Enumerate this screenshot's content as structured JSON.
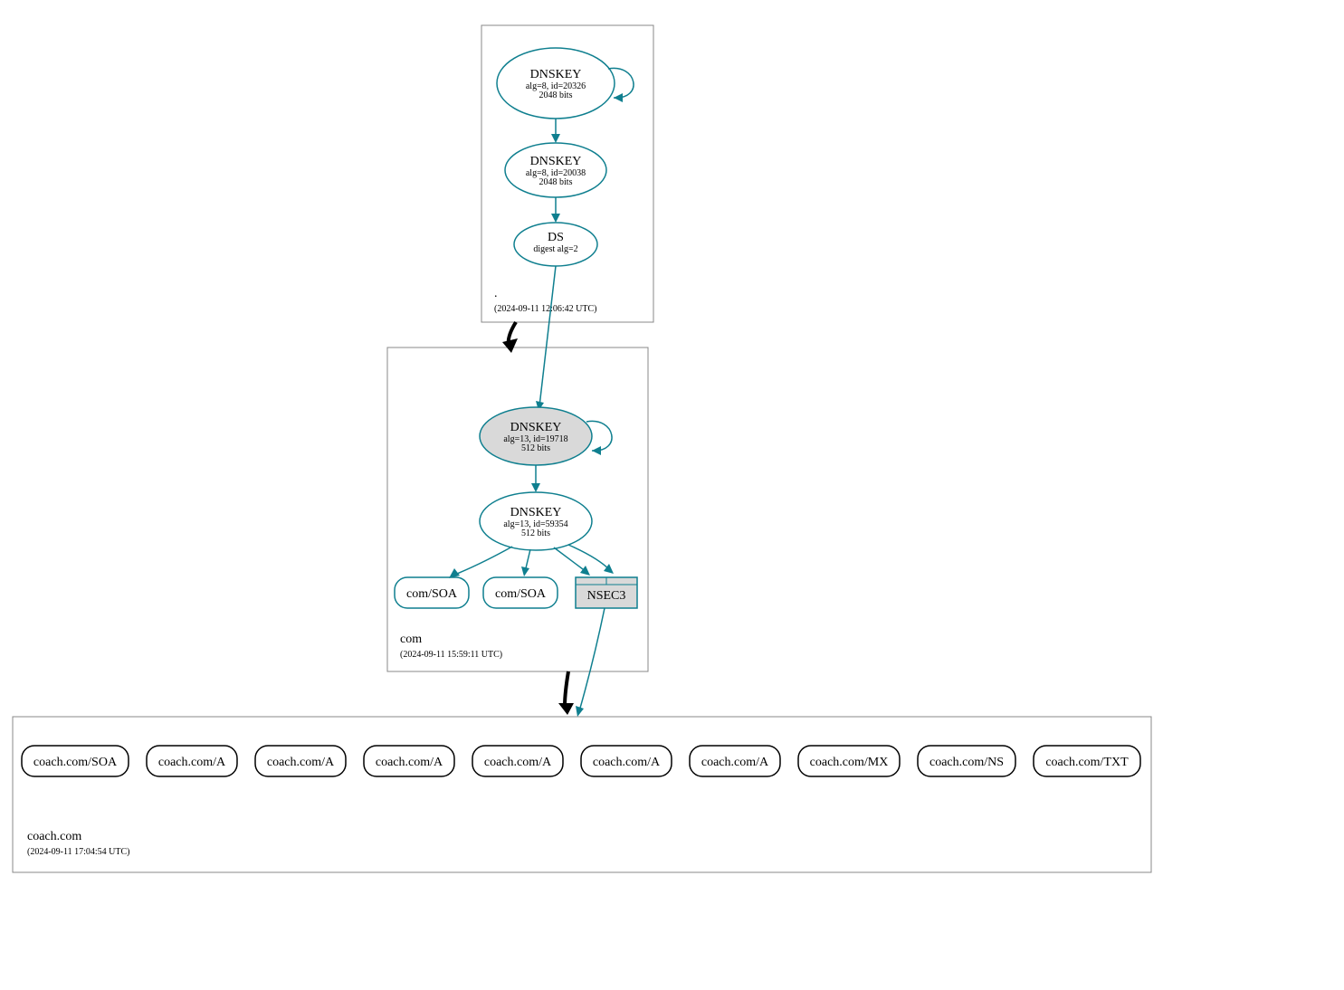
{
  "colors": {
    "teal": "#0f7f8f",
    "grey_fill": "#d9d9d9",
    "box_stroke": "#888888"
  },
  "zones": {
    "root": {
      "label": ".",
      "timestamp": "(2024-09-11 12:06:42 UTC)"
    },
    "com": {
      "label": "com",
      "timestamp": "(2024-09-11 15:59:11 UTC)"
    },
    "coach": {
      "label": "coach.com",
      "timestamp": "(2024-09-11 17:04:54 UTC)"
    }
  },
  "nodes": {
    "root_ksk": {
      "title": "DNSKEY",
      "line2": "alg=8, id=20326",
      "line3": "2048 bits"
    },
    "root_zsk": {
      "title": "DNSKEY",
      "line2": "alg=8, id=20038",
      "line3": "2048 bits"
    },
    "root_ds": {
      "title": "DS",
      "line2": "digest alg=2"
    },
    "com_ksk": {
      "title": "DNSKEY",
      "line2": "alg=13, id=19718",
      "line3": "512 bits"
    },
    "com_zsk": {
      "title": "DNSKEY",
      "line2": "alg=13, id=59354",
      "line3": "512 bits"
    },
    "com_soa1": {
      "title": "com/SOA"
    },
    "com_soa2": {
      "title": "com/SOA"
    },
    "nsec3": {
      "title": "NSEC3"
    },
    "coach_soa": {
      "title": "coach.com/SOA"
    },
    "coach_a1": {
      "title": "coach.com/A"
    },
    "coach_a2": {
      "title": "coach.com/A"
    },
    "coach_a3": {
      "title": "coach.com/A"
    },
    "coach_a4": {
      "title": "coach.com/A"
    },
    "coach_a5": {
      "title": "coach.com/A"
    },
    "coach_a6": {
      "title": "coach.com/A"
    },
    "coach_mx": {
      "title": "coach.com/MX"
    },
    "coach_ns": {
      "title": "coach.com/NS"
    },
    "coach_txt": {
      "title": "coach.com/TXT"
    }
  }
}
